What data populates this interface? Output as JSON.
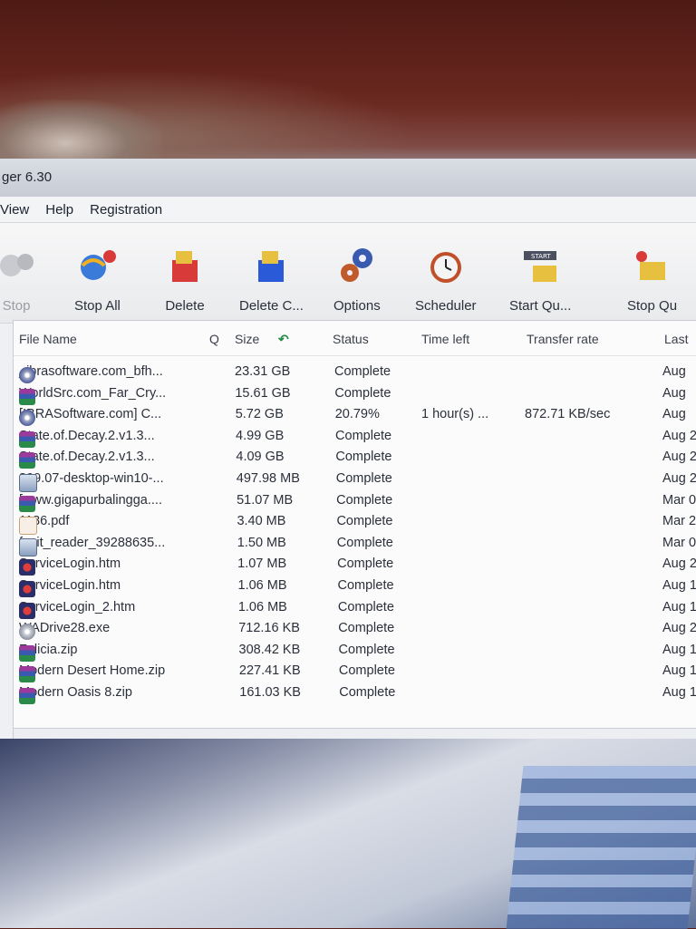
{
  "window": {
    "title": "ger 6.30"
  },
  "menu": [
    "View",
    "Help",
    "Registration"
  ],
  "toolbar": [
    {
      "label": "Stop",
      "icon": "stop-icon",
      "disabled": true
    },
    {
      "label": "Stop All",
      "icon": "stop-all-icon"
    },
    {
      "label": "Delete",
      "icon": "delete-icon"
    },
    {
      "label": "Delete C...",
      "icon": "delete-completed-icon"
    },
    {
      "label": "Options",
      "icon": "gear-icon"
    },
    {
      "label": "Scheduler",
      "icon": "alarm-clock-icon"
    },
    {
      "label": "Start Qu...",
      "icon": "start-queue-icon",
      "badge": "START"
    },
    {
      "label": "Stop Qu",
      "icon": "stop-queue-icon"
    }
  ],
  "columns": [
    "File Name",
    "Q",
    "Size",
    "Status",
    "Time left",
    "Transfer rate",
    "Last"
  ],
  "files": [
    {
      "name": "_ibrasoftware.com_bfh...",
      "icon": "disc",
      "size": "23.31 GB",
      "status": "Complete",
      "time_left": "",
      "rate": "",
      "last": "Aug"
    },
    {
      "name": "WorldSrc.com_Far_Cry...",
      "icon": "rar",
      "size": "15.61 GB",
      "status": "Complete",
      "time_left": "",
      "rate": "",
      "last": "Aug"
    },
    {
      "name": "[IBRASoftware.com] C...",
      "icon": "disc",
      "size": "5.72 GB",
      "status": "20.79%",
      "time_left": "1 hour(s) ...",
      "rate": "872.71 KB/sec",
      "last": "Aug"
    },
    {
      "name": "State.of.Decay.2.v1.3...",
      "icon": "rar",
      "size": "4.99 GB",
      "status": "Complete",
      "time_left": "",
      "rate": "",
      "last": "Aug 2"
    },
    {
      "name": "State.of.Decay.2.v1.3...",
      "icon": "rar",
      "size": "4.09 GB",
      "status": "Complete",
      "time_left": "",
      "rate": "",
      "last": "Aug 2"
    },
    {
      "name": "399.07-desktop-win10-...",
      "icon": "exe",
      "size": "497.98 MB",
      "status": "Complete",
      "time_left": "",
      "rate": "",
      "last": "Aug 2"
    },
    {
      "name": "[www.gigapurbalingga....",
      "icon": "rar",
      "size": "51.07 MB",
      "status": "Complete",
      "time_left": "",
      "rate": "",
      "last": "Mar 0"
    },
    {
      "name": "1186.pdf",
      "icon": "pdf",
      "size": "3.40 MB",
      "status": "Complete",
      "time_left": "",
      "rate": "",
      "last": "Mar 2"
    },
    {
      "name": "foxit_reader_39288635...",
      "icon": "exe",
      "size": "1.50 MB",
      "status": "Complete",
      "time_left": "",
      "rate": "",
      "last": "Mar 0"
    },
    {
      "name": "ServiceLogin.htm",
      "icon": "htm",
      "size": "1.07 MB",
      "status": "Complete",
      "time_left": "",
      "rate": "",
      "last": "Aug 2"
    },
    {
      "name": "ServiceLogin.htm",
      "icon": "htm",
      "size": "1.06 MB",
      "status": "Complete",
      "time_left": "",
      "rate": "",
      "last": "Aug 1"
    },
    {
      "name": "ServiceLogin_2.htm",
      "icon": "htm",
      "size": "1.06 MB",
      "status": "Complete",
      "time_left": "",
      "rate": "",
      "last": "Aug 1"
    },
    {
      "name": "WADrive28.exe",
      "icon": "cd",
      "size": "712.16 KB",
      "status": "Complete",
      "time_left": "",
      "rate": "",
      "last": "Aug 2"
    },
    {
      "name": "Felicia.zip",
      "icon": "rar",
      "size": "308.42 KB",
      "status": "Complete",
      "time_left": "",
      "rate": "",
      "last": "Aug 1"
    },
    {
      "name": "Modern Desert Home.zip",
      "icon": "rar",
      "size": "227.41 KB",
      "status": "Complete",
      "time_left": "",
      "rate": "",
      "last": "Aug 1"
    },
    {
      "name": "Modern Oasis 8.zip",
      "icon": "rar",
      "size": "161.03 KB",
      "status": "Complete",
      "time_left": "",
      "rate": "",
      "last": "Aug 1"
    }
  ],
  "colors": {
    "accent": "#2a8a4a",
    "text": "#2a2f3a"
  }
}
